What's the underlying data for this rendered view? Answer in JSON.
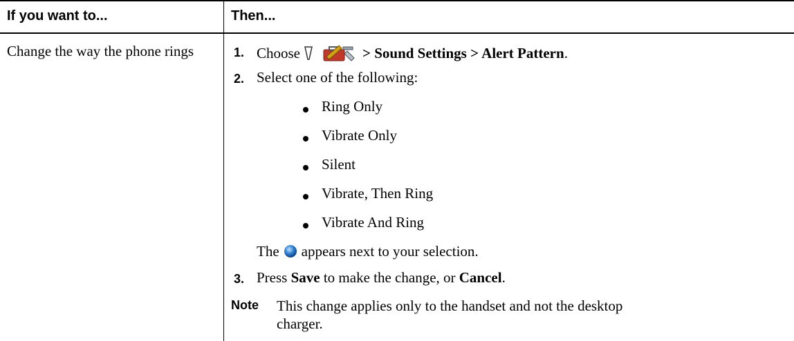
{
  "table": {
    "header": {
      "left": "If you want to...",
      "right": "Then..."
    },
    "row": {
      "action": "Change the way the phone rings",
      "steps": [
        {
          "number": "1.",
          "prefix": "Choose",
          "path": "> Sound Settings > Alert Pattern",
          "suffix": "."
        },
        {
          "number": "2.",
          "text": "Select one of the following:"
        },
        {
          "number": "3.",
          "press": "Press",
          "save": "Save",
          "middle": "to make the change, or",
          "cancel": "Cancel",
          "end": "."
        }
      ],
      "options": [
        "Ring Only",
        "Vibrate Only",
        "Silent",
        "Vibrate, Then Ring",
        "Vibrate And Ring"
      ],
      "selection_note": {
        "before": "The",
        "after": "appears next to your selection."
      },
      "note": {
        "label": "Note",
        "text": "This change applies only to the handset and not the desktop charger."
      }
    }
  },
  "icons": {
    "phone_key": "down-arrow-key-icon",
    "settings": "settings-toolbox-icon",
    "selected_indicator": "blue-ball-icon"
  },
  "colors": {
    "rule": "#000000",
    "ball": "#2f7fd0",
    "toolbox": "#c0392b"
  }
}
